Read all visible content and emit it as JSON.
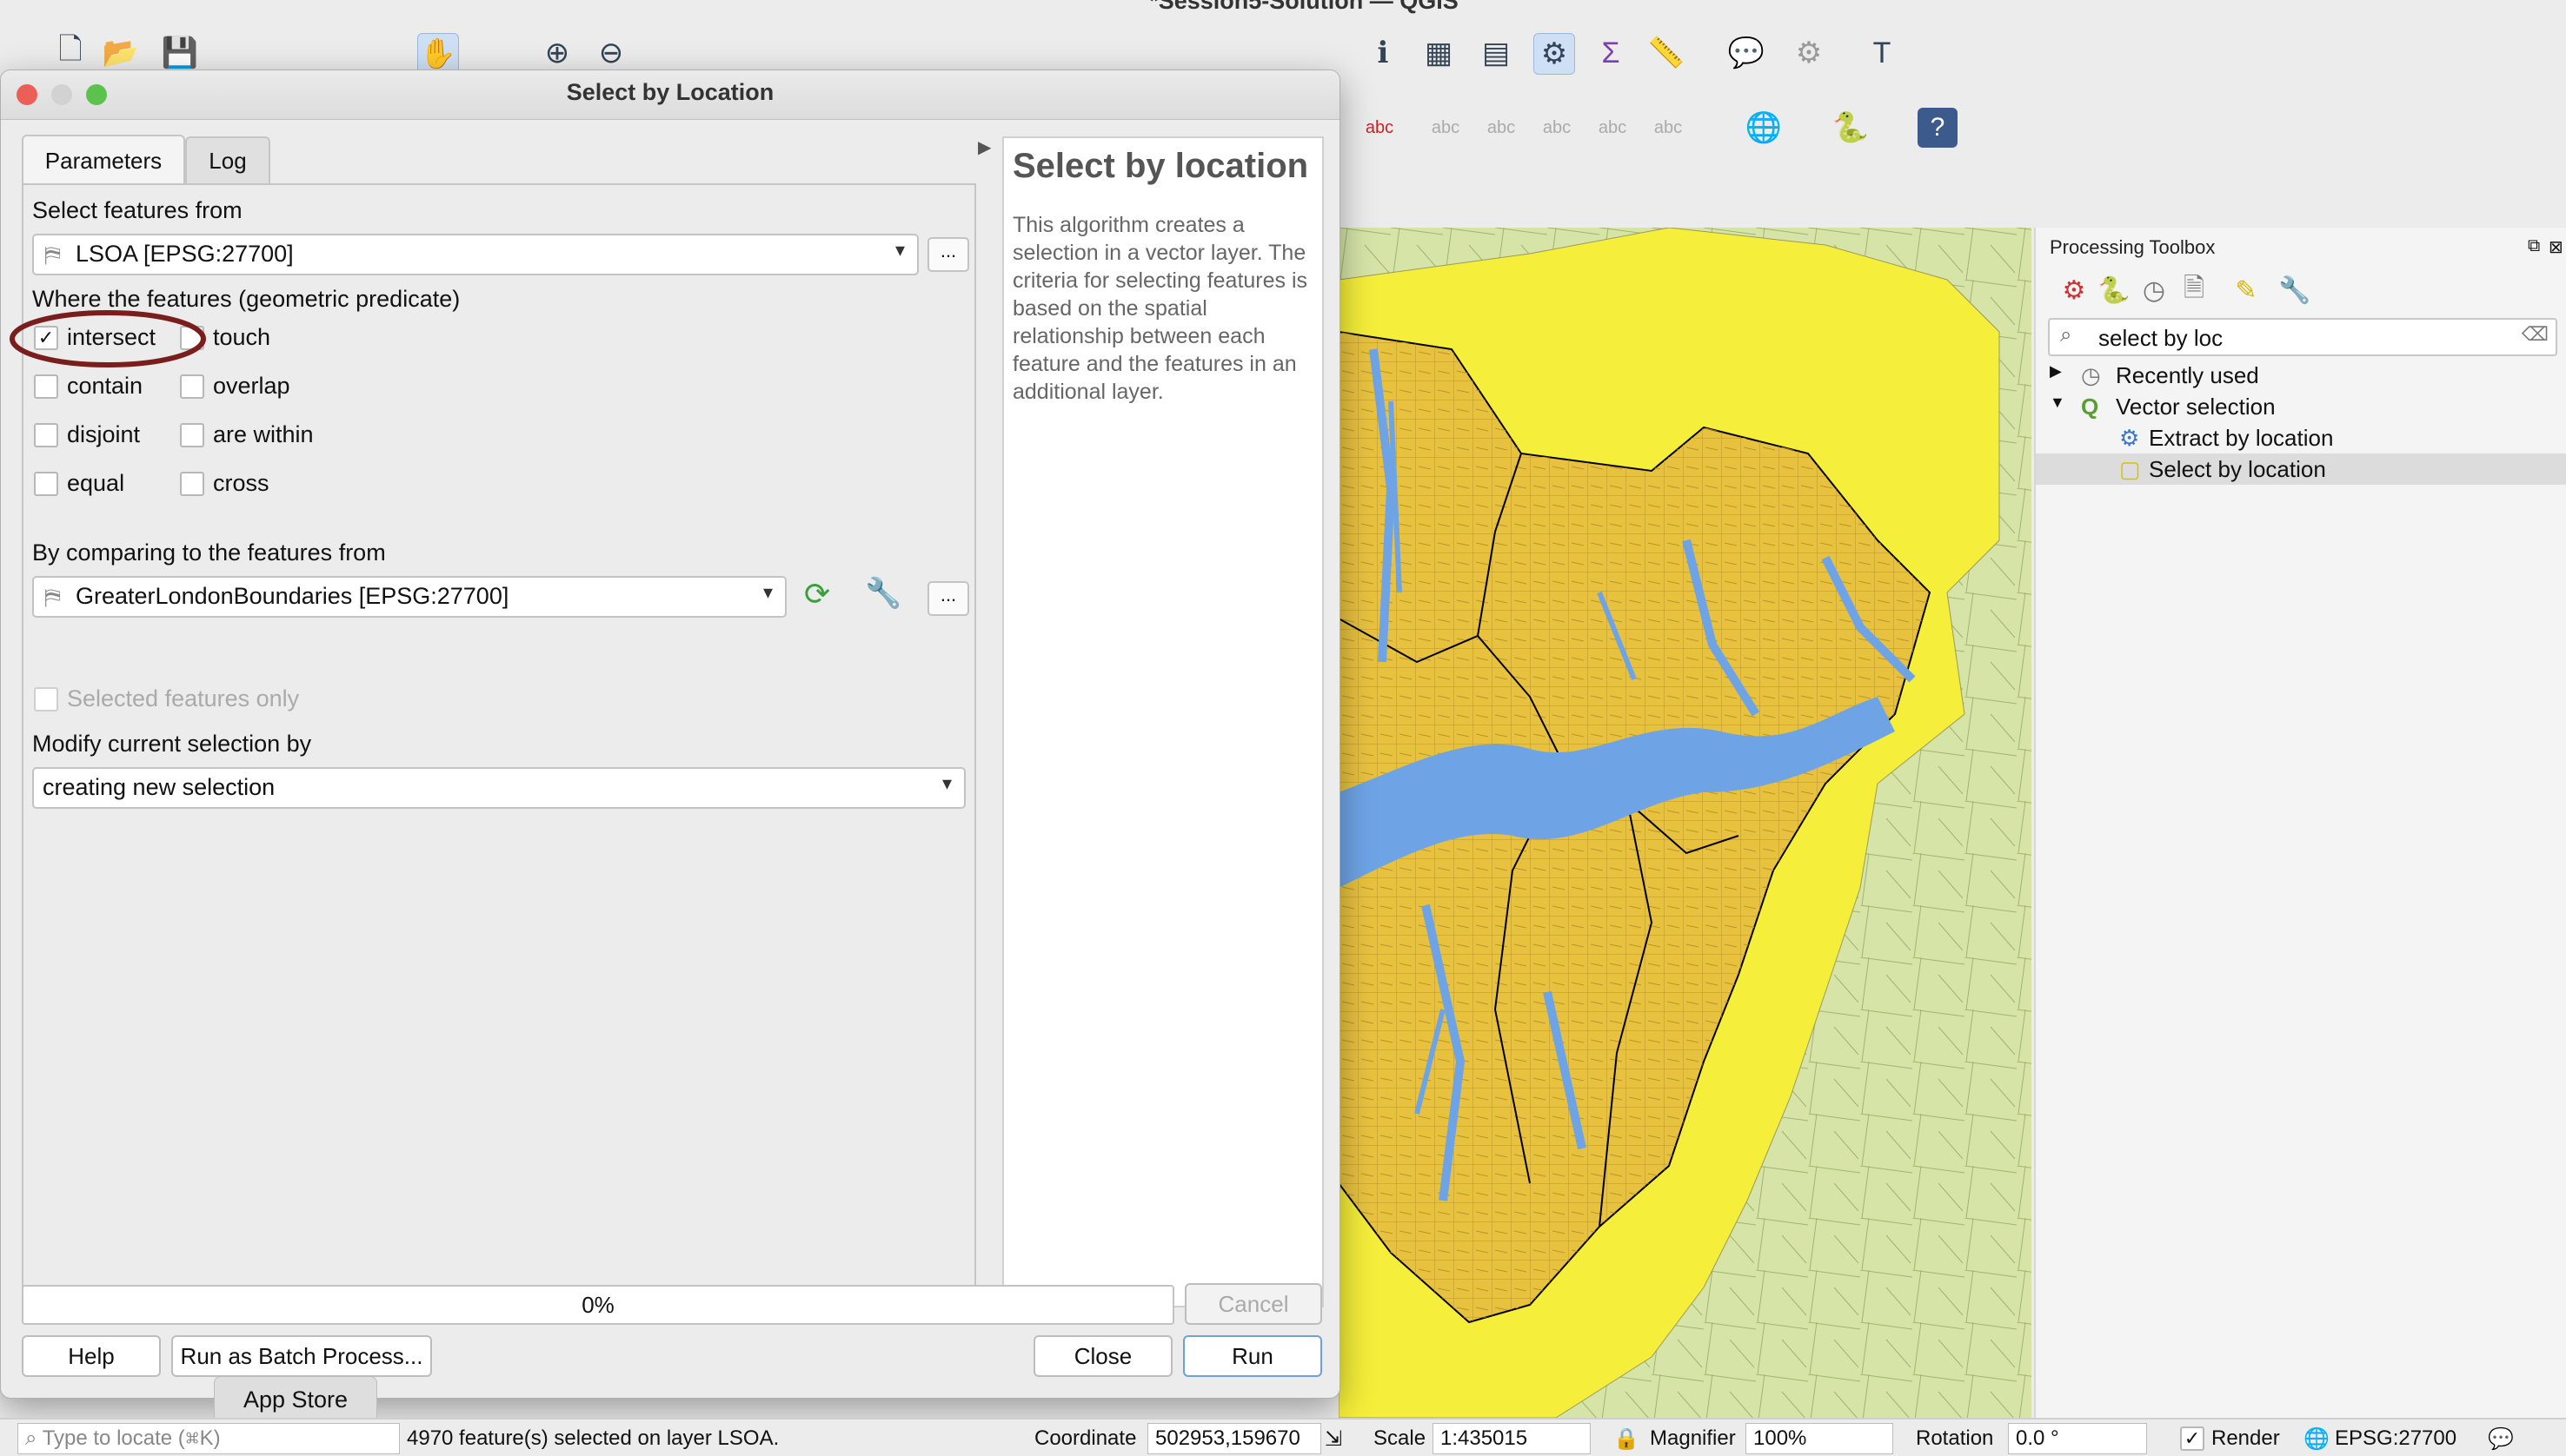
{
  "window": {
    "title": "*Session5-Solution — QGIS"
  },
  "dialog": {
    "title": "Select by Location",
    "tabs": [
      "Parameters",
      "Log"
    ],
    "select_from_label": "Select features from",
    "select_from_value": "LSOA [EPSG:27700]",
    "browse_label": "...",
    "predicate_label": "Where the features (geometric predicate)",
    "predicates": [
      {
        "label": "intersect",
        "checked": true
      },
      {
        "label": "touch",
        "checked": false
      },
      {
        "label": "contain",
        "checked": false
      },
      {
        "label": "overlap",
        "checked": false
      },
      {
        "label": "disjoint",
        "checked": false
      },
      {
        "label": "are within",
        "checked": false
      },
      {
        "label": "equal",
        "checked": false
      },
      {
        "label": "cross",
        "checked": false
      }
    ],
    "compare_label": "By comparing to the features from",
    "compare_value": "GreaterLondonBoundaries [EPSG:27700]",
    "selected_only_label": "Selected features only",
    "modify_label": "Modify current selection by",
    "modify_value": "creating new selection",
    "help_title": "Select by location",
    "help_text": "This algorithm creates a selection in a vector layer. The criteria for selecting features is based on the spatial relationship between each feature and the features in an additional layer.",
    "progress_text": "0%",
    "cancel_label": "Cancel",
    "help_button": "Help",
    "batch_button": "Run as Batch Process...",
    "close_button": "Close",
    "run_button": "Run"
  },
  "tooltip": "App Store",
  "toolbox": {
    "title": "Processing Toolbox",
    "search_value": "select by loc",
    "tree": [
      {
        "label": "Recently used",
        "icon": "clock-icon"
      },
      {
        "label": "Vector selection",
        "icon": "qgis-q-icon"
      },
      {
        "label": "Extract by location",
        "icon": "gear-icon"
      },
      {
        "label": "Select by location",
        "icon": "select-icon"
      }
    ]
  },
  "statusbar": {
    "locate_placeholder": "Type to locate (⌘K)",
    "message": "4970 feature(s) selected on layer LSOA.",
    "coordinate_label": "Coordinate",
    "coordinate_value": "502953,159670",
    "scale_label": "Scale",
    "scale_value": "1:435015",
    "magnifier_label": "Magnifier",
    "magnifier_value": "100%",
    "rotation_label": "Rotation",
    "rotation_value": "0.0 °",
    "render_label": "Render",
    "crs": "EPSG:27700"
  },
  "colors": {
    "map_background": "#d6e4a8",
    "london_yellow": "#f5ee3a",
    "selected_lsoa": "#e8c23f",
    "water": "#6ea4e6",
    "annotation_circle": "#7a1d1d"
  }
}
